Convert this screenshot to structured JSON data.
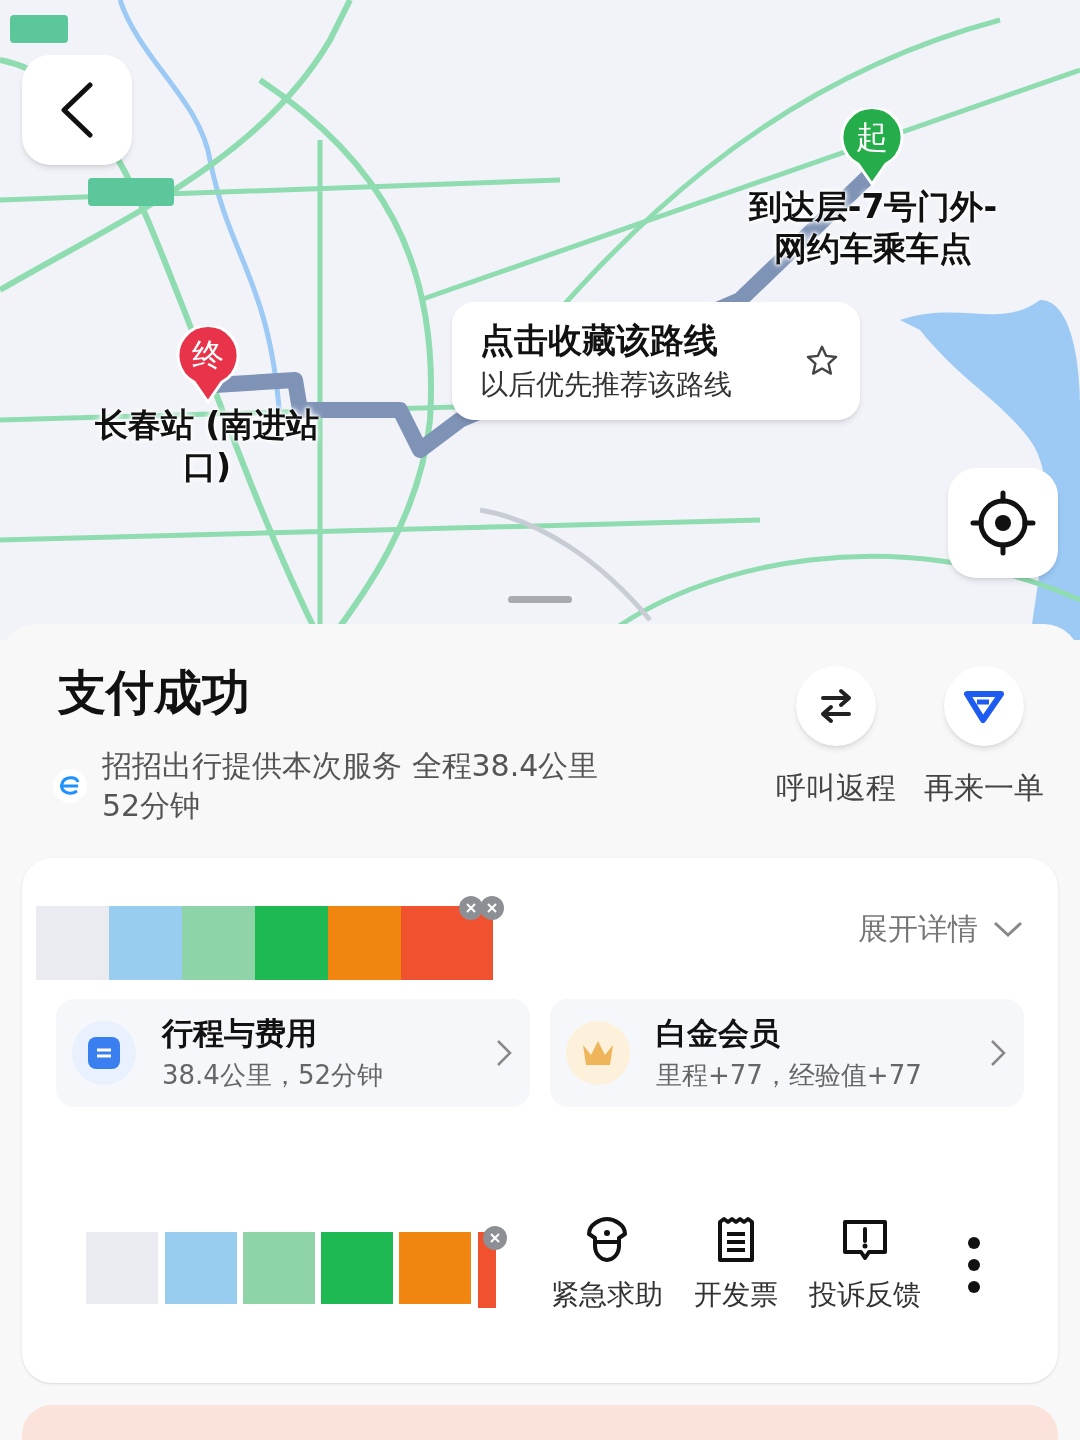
{
  "route_markers": [
    {
      "kind": "start",
      "pin": "起",
      "label": "到达层-7号门外-网约车乘车点"
    },
    {
      "kind": "end",
      "pin": "终",
      "label": "长春站 (南进站口)"
    }
  ],
  "favorite_prompt": {
    "title": "点击收藏该路线",
    "subtitle": "以后优先推荐该路线",
    "starred": false
  },
  "status": {
    "title": "支付成功",
    "provider_info": "招招出行提供本次服务 全程38.4公里 52分钟"
  },
  "quick_actions": [
    {
      "kind": "return",
      "label": "呼叫返程"
    },
    {
      "kind": "reorder",
      "label": "再来一单"
    }
  ],
  "details_toggle": {
    "label": "展开详情",
    "expanded": false
  },
  "summary_cards": [
    {
      "kind": "trip",
      "title": "行程与费用",
      "subtitle": "38.4公里，52分钟"
    },
    {
      "kind": "member",
      "title": "白金会员",
      "subtitle": "里程+77，经验值+77"
    }
  ],
  "services": [
    {
      "kind": "emergency",
      "label": "紧急求助"
    },
    {
      "kind": "invoice",
      "label": "开发票"
    },
    {
      "kind": "feedback",
      "label": "投诉反馈"
    }
  ]
}
